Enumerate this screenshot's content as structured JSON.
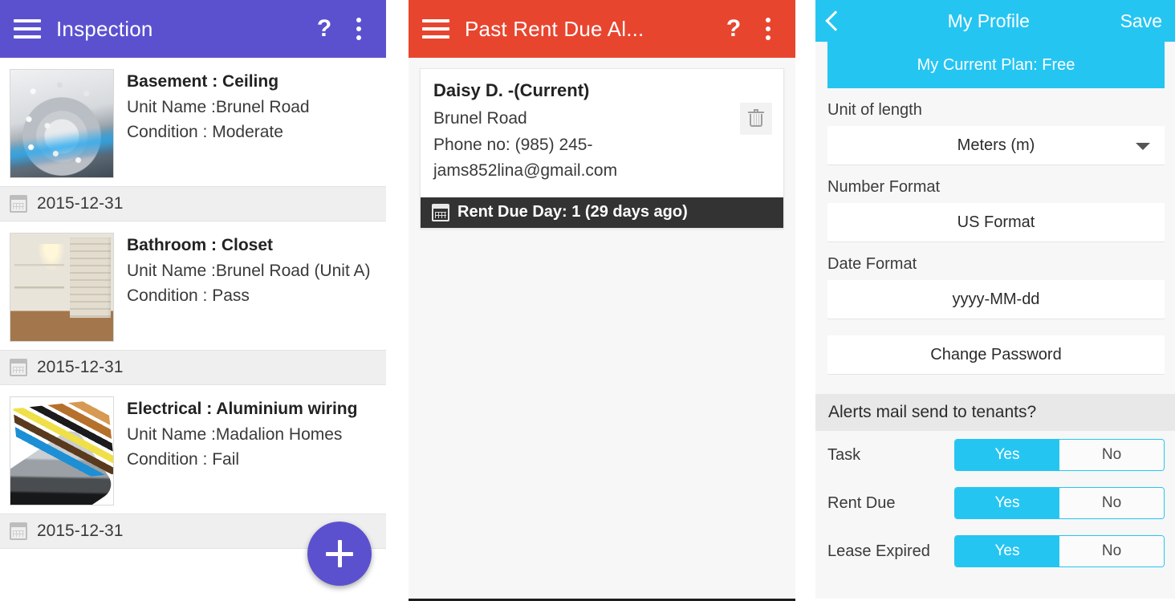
{
  "inspection": {
    "appbar": {
      "menu_icon": "hamburger-menu-icon",
      "title": "Inspection",
      "help_label": "?",
      "overflow_icon": "kebab-menu-icon"
    },
    "items": [
      {
        "title": "Basement : Ceiling",
        "unit_line": "Unit Name :Brunel Road",
        "condition_line": "Condition : Moderate",
        "date": "2015-12-31",
        "thumb": "ceiling-photo"
      },
      {
        "title": "Bathroom : Closet",
        "unit_line": "Unit Name :Brunel Road (Unit A)",
        "condition_line": "Condition : Pass",
        "date": "2015-12-31",
        "thumb": "closet-photo"
      },
      {
        "title": "Electrical : Aluminium wiring",
        "unit_line": "Unit Name :Madalion Homes",
        "condition_line": "Condition : Fail",
        "date": "2015-12-31",
        "thumb": "wiring-photo"
      }
    ],
    "fab": {
      "icon": "plus-icon",
      "label": "+"
    },
    "accent": "#5b51cf"
  },
  "rent_alerts": {
    "appbar": {
      "menu_icon": "hamburger-menu-icon",
      "title": "Past Rent Due Al...",
      "help_label": "?",
      "overflow_icon": "kebab-menu-icon"
    },
    "card": {
      "name": "Daisy D. -(Current)",
      "property": "Brunel Road",
      "phone": "Phone no: (985) 245-",
      "email": "jams852lina@gmail.com",
      "delete_icon": "trash-icon",
      "due_bar": {
        "icon": "calendar-icon",
        "text": "Rent Due Day: 1 (29 days ago)"
      }
    },
    "accent": "#e8452f"
  },
  "profile": {
    "appbar": {
      "back_icon": "chevron-left-icon",
      "title": "My Profile",
      "save_label": "Save"
    },
    "plan_banner": "My Current Plan: Free",
    "fields": [
      {
        "label": "Unit of length",
        "value": "Meters (m)",
        "has_caret": true,
        "caret_icon": "chevron-down-icon"
      },
      {
        "label": "Number Format",
        "value": "US Format",
        "has_caret": false
      },
      {
        "label": "Date Format",
        "value": "yyyy-MM-dd",
        "has_caret": false
      }
    ],
    "change_password_label": "Change Password",
    "alerts_section_title": "Alerts mail send to tenants?",
    "toggles": [
      {
        "label": "Task",
        "yes_label": "Yes",
        "no_label": "No",
        "selected": "Yes"
      },
      {
        "label": "Rent Due",
        "yes_label": "Yes",
        "no_label": "No",
        "selected": "Yes"
      },
      {
        "label": "Lease Expired",
        "yes_label": "Yes",
        "no_label": "No",
        "selected": "Yes"
      }
    ],
    "accent": "#25c5f2"
  }
}
